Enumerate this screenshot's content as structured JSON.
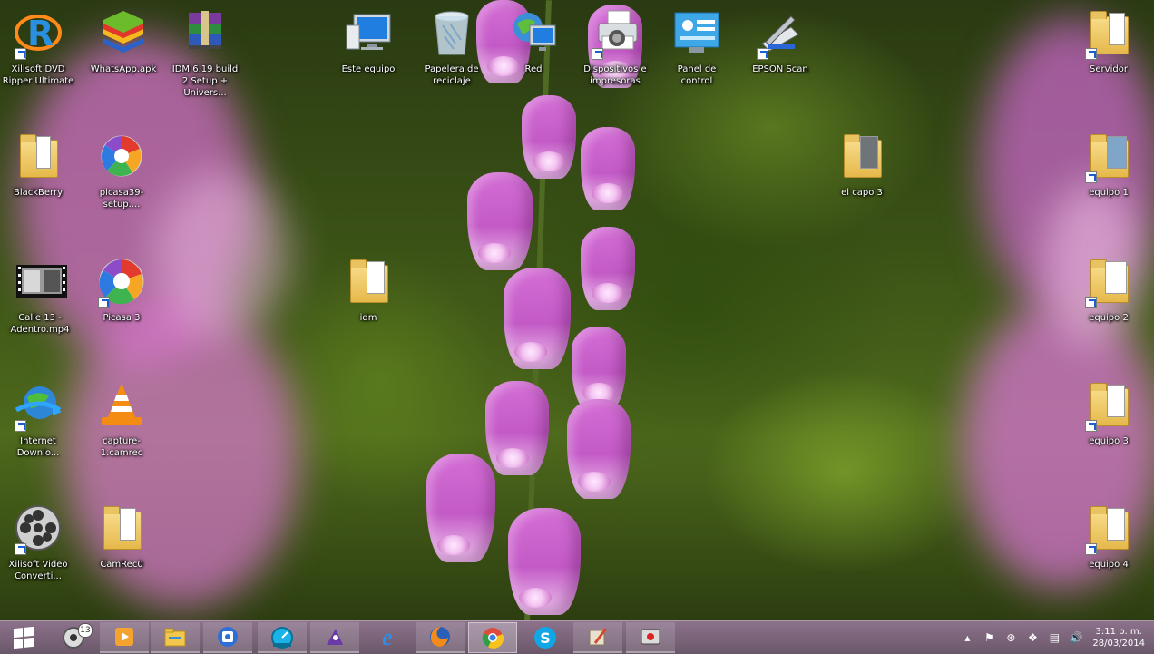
{
  "desktop": {
    "icons": [
      {
        "id": "xilisoft-dvd",
        "label": "Xilisoft DVD Ripper Ultimate",
        "icon": "xilisoft-r-icon",
        "shortcut": true
      },
      {
        "id": "whatsapp-apk",
        "label": "WhatsApp.apk",
        "icon": "bluestacks-icon",
        "shortcut": false
      },
      {
        "id": "idm-setup",
        "label": "IDM 6.19 build 2 Setup + Univers...",
        "icon": "winrar-icon",
        "shortcut": false
      },
      {
        "id": "este-equipo",
        "label": "Este equipo",
        "icon": "computer-icon",
        "shortcut": false
      },
      {
        "id": "papelera",
        "label": "Papelera de reciclaje",
        "icon": "recycle-bin-icon",
        "shortcut": false
      },
      {
        "id": "red",
        "label": "Red",
        "icon": "network-icon",
        "shortcut": false
      },
      {
        "id": "dispositivos",
        "label": "Dispositivos e impresoras",
        "icon": "printer-icon",
        "shortcut": true
      },
      {
        "id": "panel-control",
        "label": "Panel de control",
        "icon": "control-panel-icon",
        "shortcut": false
      },
      {
        "id": "epson-scan",
        "label": "EPSON Scan",
        "icon": "scanner-icon",
        "shortcut": true
      },
      {
        "id": "servidor",
        "label": "Servidor",
        "icon": "folder-icon",
        "shortcut": true
      },
      {
        "id": "blackberry",
        "label": "BlackBerry",
        "icon": "folder-icon",
        "shortcut": false
      },
      {
        "id": "picasa-setup",
        "label": "picasa39-setup....",
        "icon": "picasa-icon",
        "shortcut": false
      },
      {
        "id": "el-capo",
        "label": "el capo 3",
        "icon": "folder-icon",
        "shortcut": false
      },
      {
        "id": "equipo-1",
        "label": "equipo 1",
        "icon": "folder-icon",
        "shortcut": true
      },
      {
        "id": "calle-13",
        "label": "Calle 13 - Adentro.mp4",
        "icon": "video-file-icon",
        "shortcut": false
      },
      {
        "id": "picasa-3",
        "label": "Picasa 3",
        "icon": "picasa-icon",
        "shortcut": true
      },
      {
        "id": "idm-folder",
        "label": "idm",
        "icon": "folder-icon",
        "shortcut": false
      },
      {
        "id": "equipo-2",
        "label": "equipo 2",
        "icon": "folder-icon",
        "shortcut": true
      },
      {
        "id": "internet-download",
        "label": "Internet Downlo...",
        "icon": "idm-globe-icon",
        "shortcut": true
      },
      {
        "id": "capture-camrec",
        "label": "capture-1.camrec",
        "icon": "vlc-cone-icon",
        "shortcut": false
      },
      {
        "id": "equipo-3",
        "label": "equipo 3",
        "icon": "folder-icon",
        "shortcut": true
      },
      {
        "id": "xilisoft-video",
        "label": "Xilisoft Video Converti...",
        "icon": "film-reel-icon",
        "shortcut": true
      },
      {
        "id": "camrec0",
        "label": "CamRec0",
        "icon": "folder-icon",
        "shortcut": false
      },
      {
        "id": "equipo-4",
        "label": "equipo 4",
        "icon": "folder-icon",
        "shortcut": true
      }
    ]
  },
  "taskbar": {
    "start_icon": "windows-logo-icon",
    "notification_badge": "13",
    "buttons": [
      {
        "id": "media-center",
        "icon": "media-center-icon"
      },
      {
        "id": "media-player",
        "icon": "media-player-icon"
      },
      {
        "id": "file-explorer",
        "icon": "file-explorer-icon"
      },
      {
        "id": "phone",
        "icon": "phone-icon"
      },
      {
        "id": "speedometer",
        "icon": "speed-icon"
      },
      {
        "id": "recorder",
        "icon": "recorder-icon"
      },
      {
        "id": "internet-explorer",
        "icon": "ie-icon",
        "glyph": "e"
      },
      {
        "id": "firefox",
        "icon": "firefox-icon"
      },
      {
        "id": "chrome",
        "icon": "chrome-icon"
      },
      {
        "id": "skype",
        "icon": "skype-icon",
        "glyph": "S"
      },
      {
        "id": "app-tool",
        "icon": "tool-icon"
      },
      {
        "id": "camrec",
        "icon": "camrec-icon"
      }
    ],
    "tray": {
      "clock_time": "3:11 p. m.",
      "clock_date": "28/03/2014"
    }
  },
  "colors": {
    "taskbar": "#7d6a7f",
    "accent_pink": "#c95cc9",
    "foliage": "#4e6a1c"
  }
}
